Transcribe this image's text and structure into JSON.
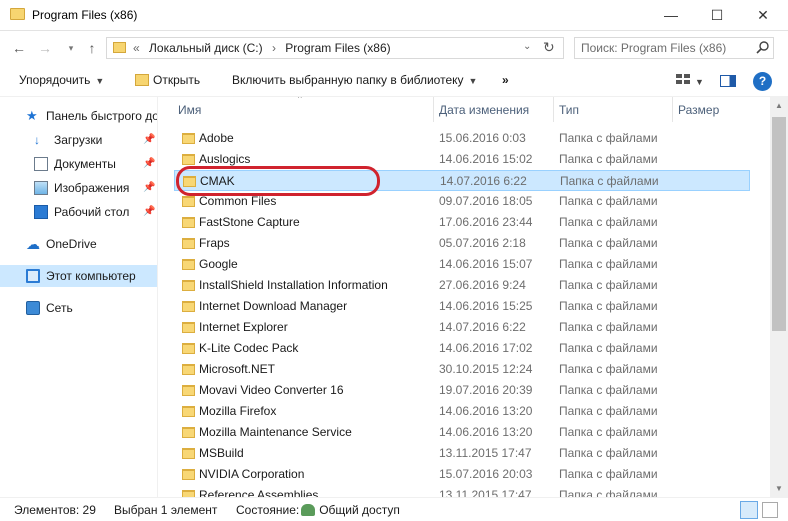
{
  "window": {
    "title": "Program Files (x86)",
    "minimize_glyph": "—",
    "maximize_glyph": "☐",
    "close_glyph": "✕"
  },
  "nav_buttons": {
    "back": "←",
    "forward": "→",
    "recent": "▾",
    "up": "↑"
  },
  "address": {
    "prefix": "«",
    "crumbs": [
      "Локальный диск (C:)",
      "Program Files (x86)"
    ],
    "separator": "›",
    "dropdown_glyph": "⌄",
    "refresh_glyph": "↻"
  },
  "search": {
    "placeholder": "Поиск: Program Files (x86)"
  },
  "toolbar": {
    "organize": "Упорядочить",
    "open": "Открыть",
    "include": "Включить выбранную папку в библиотеку",
    "more": "»",
    "caret": "▼",
    "help": "?"
  },
  "navpane": {
    "items": [
      {
        "label": "Панель быстрого доступа",
        "icon": "star-icon",
        "glyph": "★",
        "pinned": false
      },
      {
        "label": "Загрузки",
        "icon": "download-icon",
        "glyph": "↓",
        "pinned": true
      },
      {
        "label": "Документы",
        "icon": "document-icon",
        "glyph": "",
        "pinned": true
      },
      {
        "label": "Изображения",
        "icon": "pictures-icon",
        "glyph": "",
        "pinned": true
      },
      {
        "label": "Рабочий стол",
        "icon": "desktop-icon",
        "glyph": "",
        "pinned": true
      },
      {
        "label": "OneDrive",
        "icon": "cloud-icon",
        "glyph": "☁",
        "pinned": false
      },
      {
        "label": "Этот компьютер",
        "icon": "computer-icon",
        "glyph": "",
        "pinned": false
      },
      {
        "label": "Сеть",
        "icon": "network-icon",
        "glyph": "",
        "pinned": false
      }
    ],
    "pin_glyph": "📌"
  },
  "columns": {
    "name": "Имя",
    "date": "Дата изменения",
    "type": "Тип",
    "size": "Размер",
    "sort_glyph": "^"
  },
  "files": [
    {
      "name": "Adobe",
      "date": "15.06.2016 0:03",
      "type": "Папка с файлами"
    },
    {
      "name": "Auslogics",
      "date": "14.06.2016 15:02",
      "type": "Папка с файлами"
    },
    {
      "name": "CMAK",
      "date": "14.07.2016 6:22",
      "type": "Папка с файлами",
      "selected": true
    },
    {
      "name": "Common Files",
      "date": "09.07.2016 18:05",
      "type": "Папка с файлами"
    },
    {
      "name": "FastStone Capture",
      "date": "17.06.2016 23:44",
      "type": "Папка с файлами"
    },
    {
      "name": "Fraps",
      "date": "05.07.2016 2:18",
      "type": "Папка с файлами"
    },
    {
      "name": "Google",
      "date": "14.06.2016 15:07",
      "type": "Папка с файлами"
    },
    {
      "name": "InstallShield Installation Information",
      "date": "27.06.2016 9:24",
      "type": "Папка с файлами"
    },
    {
      "name": "Internet Download Manager",
      "date": "14.06.2016 15:25",
      "type": "Папка с файлами"
    },
    {
      "name": "Internet Explorer",
      "date": "14.07.2016 6:22",
      "type": "Папка с файлами"
    },
    {
      "name": "K-Lite Codec Pack",
      "date": "14.06.2016 17:02",
      "type": "Папка с файлами"
    },
    {
      "name": "Microsoft.NET",
      "date": "30.10.2015 12:24",
      "type": "Папка с файлами"
    },
    {
      "name": "Movavi Video Converter 16",
      "date": "19.07.2016 20:39",
      "type": "Папка с файлами"
    },
    {
      "name": "Mozilla Firefox",
      "date": "14.06.2016 13:20",
      "type": "Папка с файлами"
    },
    {
      "name": "Mozilla Maintenance Service",
      "date": "14.06.2016 13:20",
      "type": "Папка с файлами"
    },
    {
      "name": "MSBuild",
      "date": "13.11.2015 17:47",
      "type": "Папка с файлами"
    },
    {
      "name": "NVIDIA Corporation",
      "date": "15.07.2016 20:03",
      "type": "Папка с файлами"
    },
    {
      "name": "Reference Assemblies",
      "date": "13.11.2015 17:47",
      "type": "Папка с файлами"
    }
  ],
  "scroll": {
    "up": "▲",
    "down": "▼"
  },
  "status": {
    "count": "Элементов: 29",
    "selected": "Выбран 1 элемент",
    "state_label": "Состояние:",
    "state_value": "Общий доступ"
  },
  "colors": {
    "selection": "#cce8ff",
    "highlight_ring": "#d0232e",
    "folder": "#f8d775"
  }
}
